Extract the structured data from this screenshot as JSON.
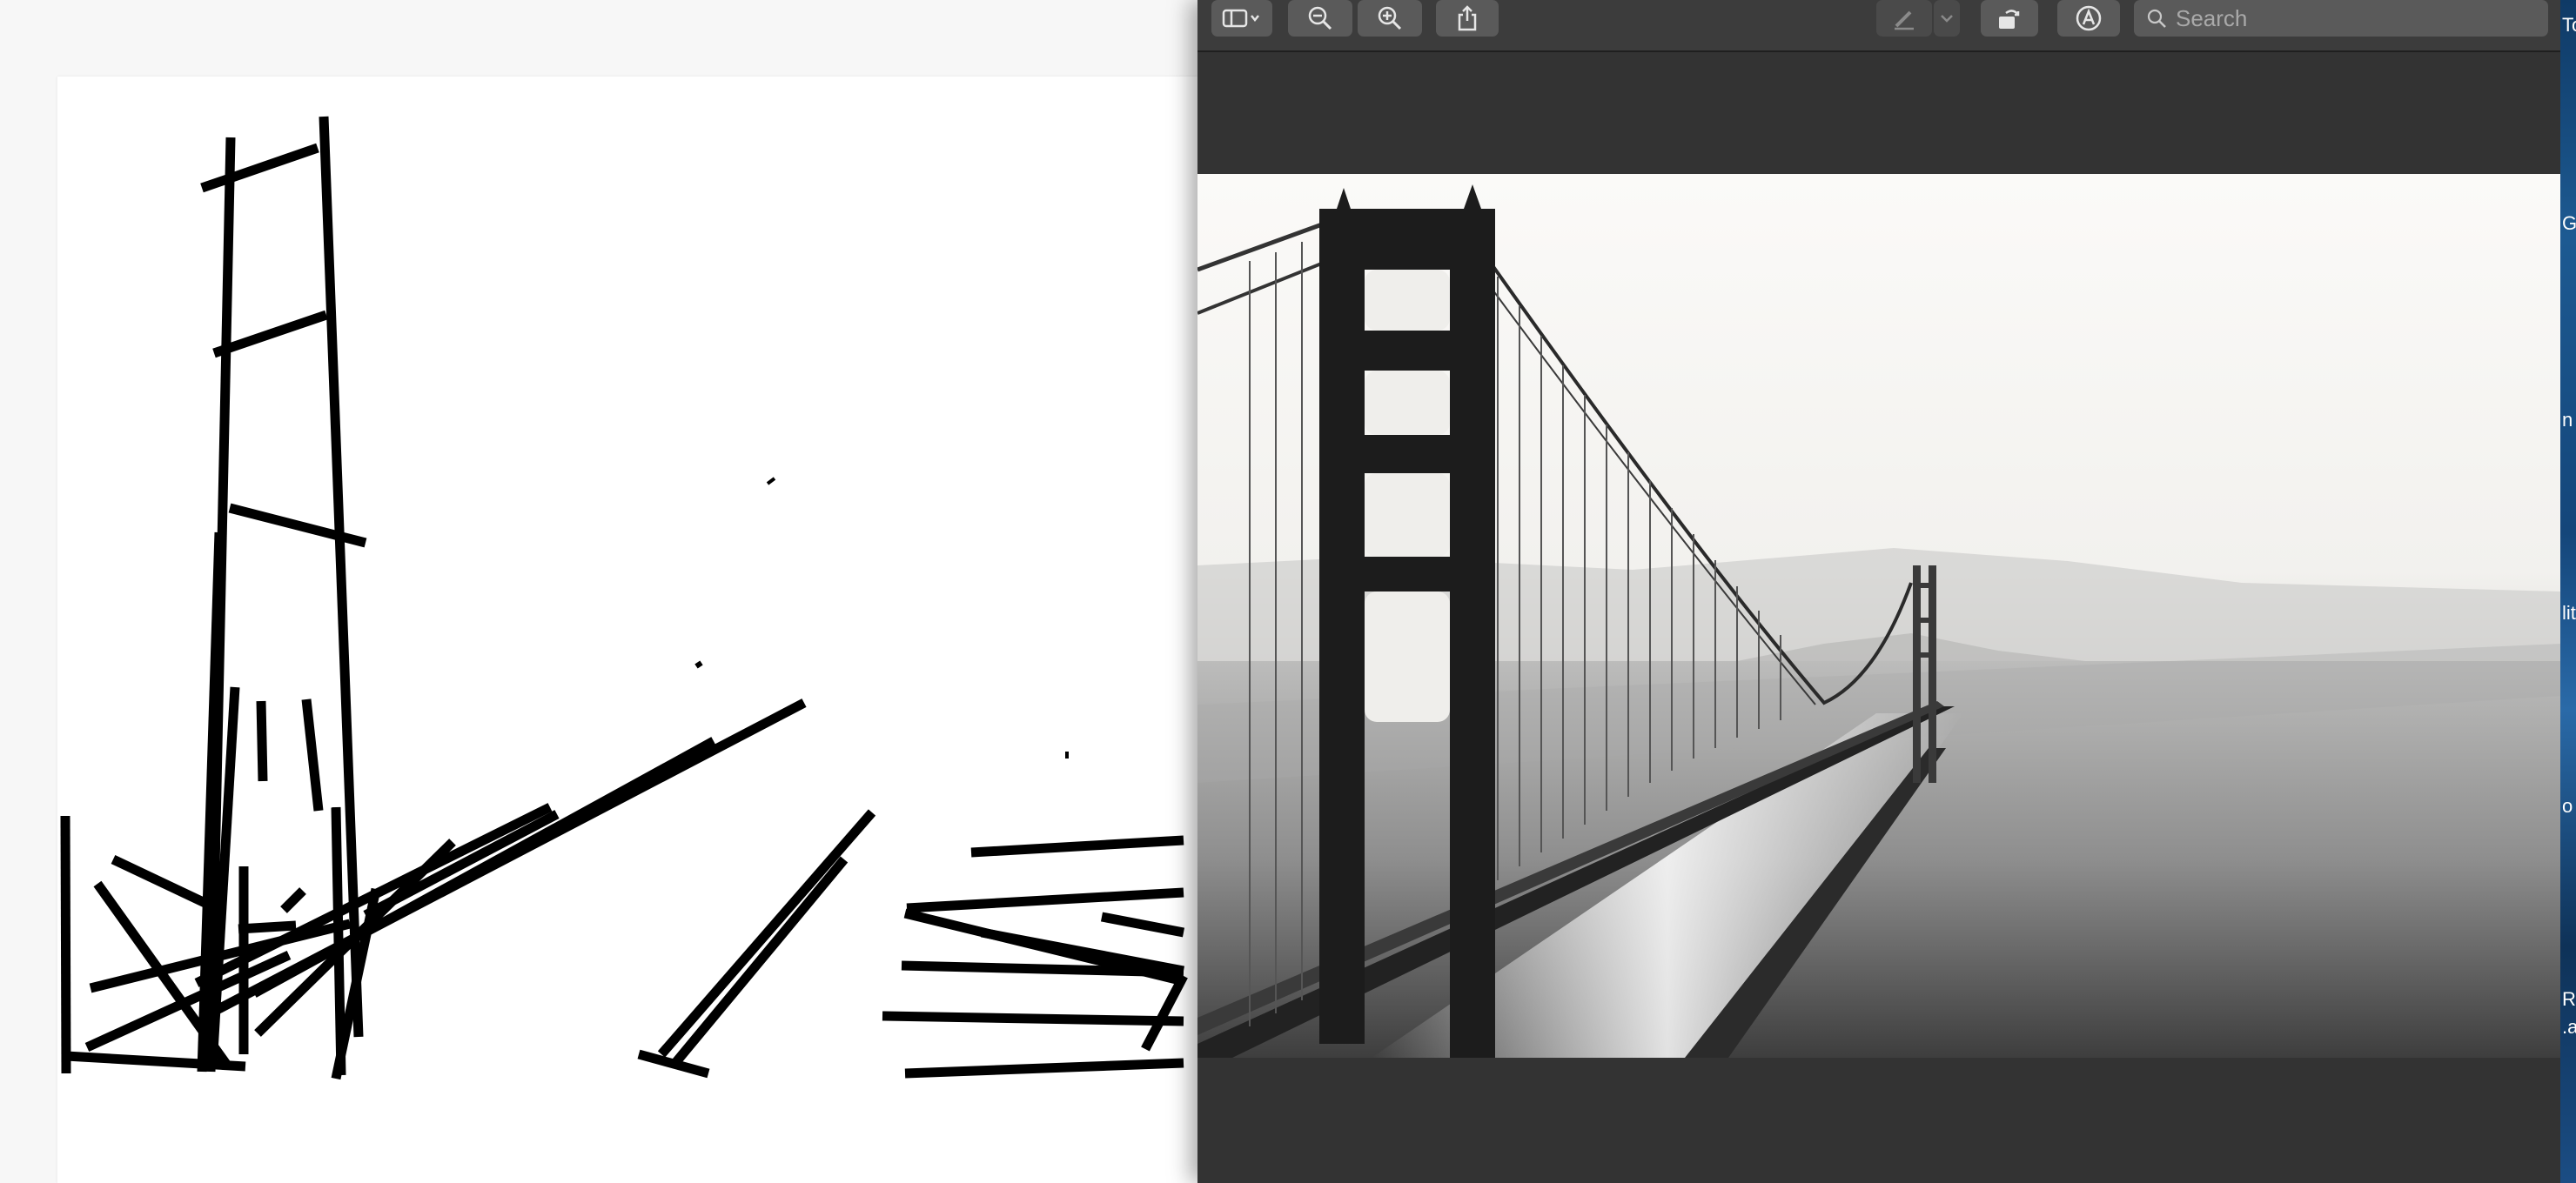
{
  "preview": {
    "toolbar": {
      "search_placeholder": "Search"
    },
    "icons": {
      "sidebar": "sidebar-icon",
      "zoom_out": "zoom-out-icon",
      "zoom_in": "zoom-in-icon",
      "share": "share-icon",
      "markup_pen": "pen-icon",
      "rotate": "rotate-icon",
      "annotate": "annotate-icon",
      "search": "search-icon"
    },
    "image_subject": "Golden Gate Bridge in fog (black and white)"
  },
  "desktop_strip": {
    "chars": [
      "To",
      "G",
      "n",
      "lit",
      "o",
      "RU",
      ".a"
    ]
  },
  "colors": {
    "toolbar_bg": "#3c3c3c",
    "button_bg": "#5a5a5a",
    "window_bg": "#333333",
    "canvas_bg": "#ffffff",
    "stroke": "#000000"
  }
}
